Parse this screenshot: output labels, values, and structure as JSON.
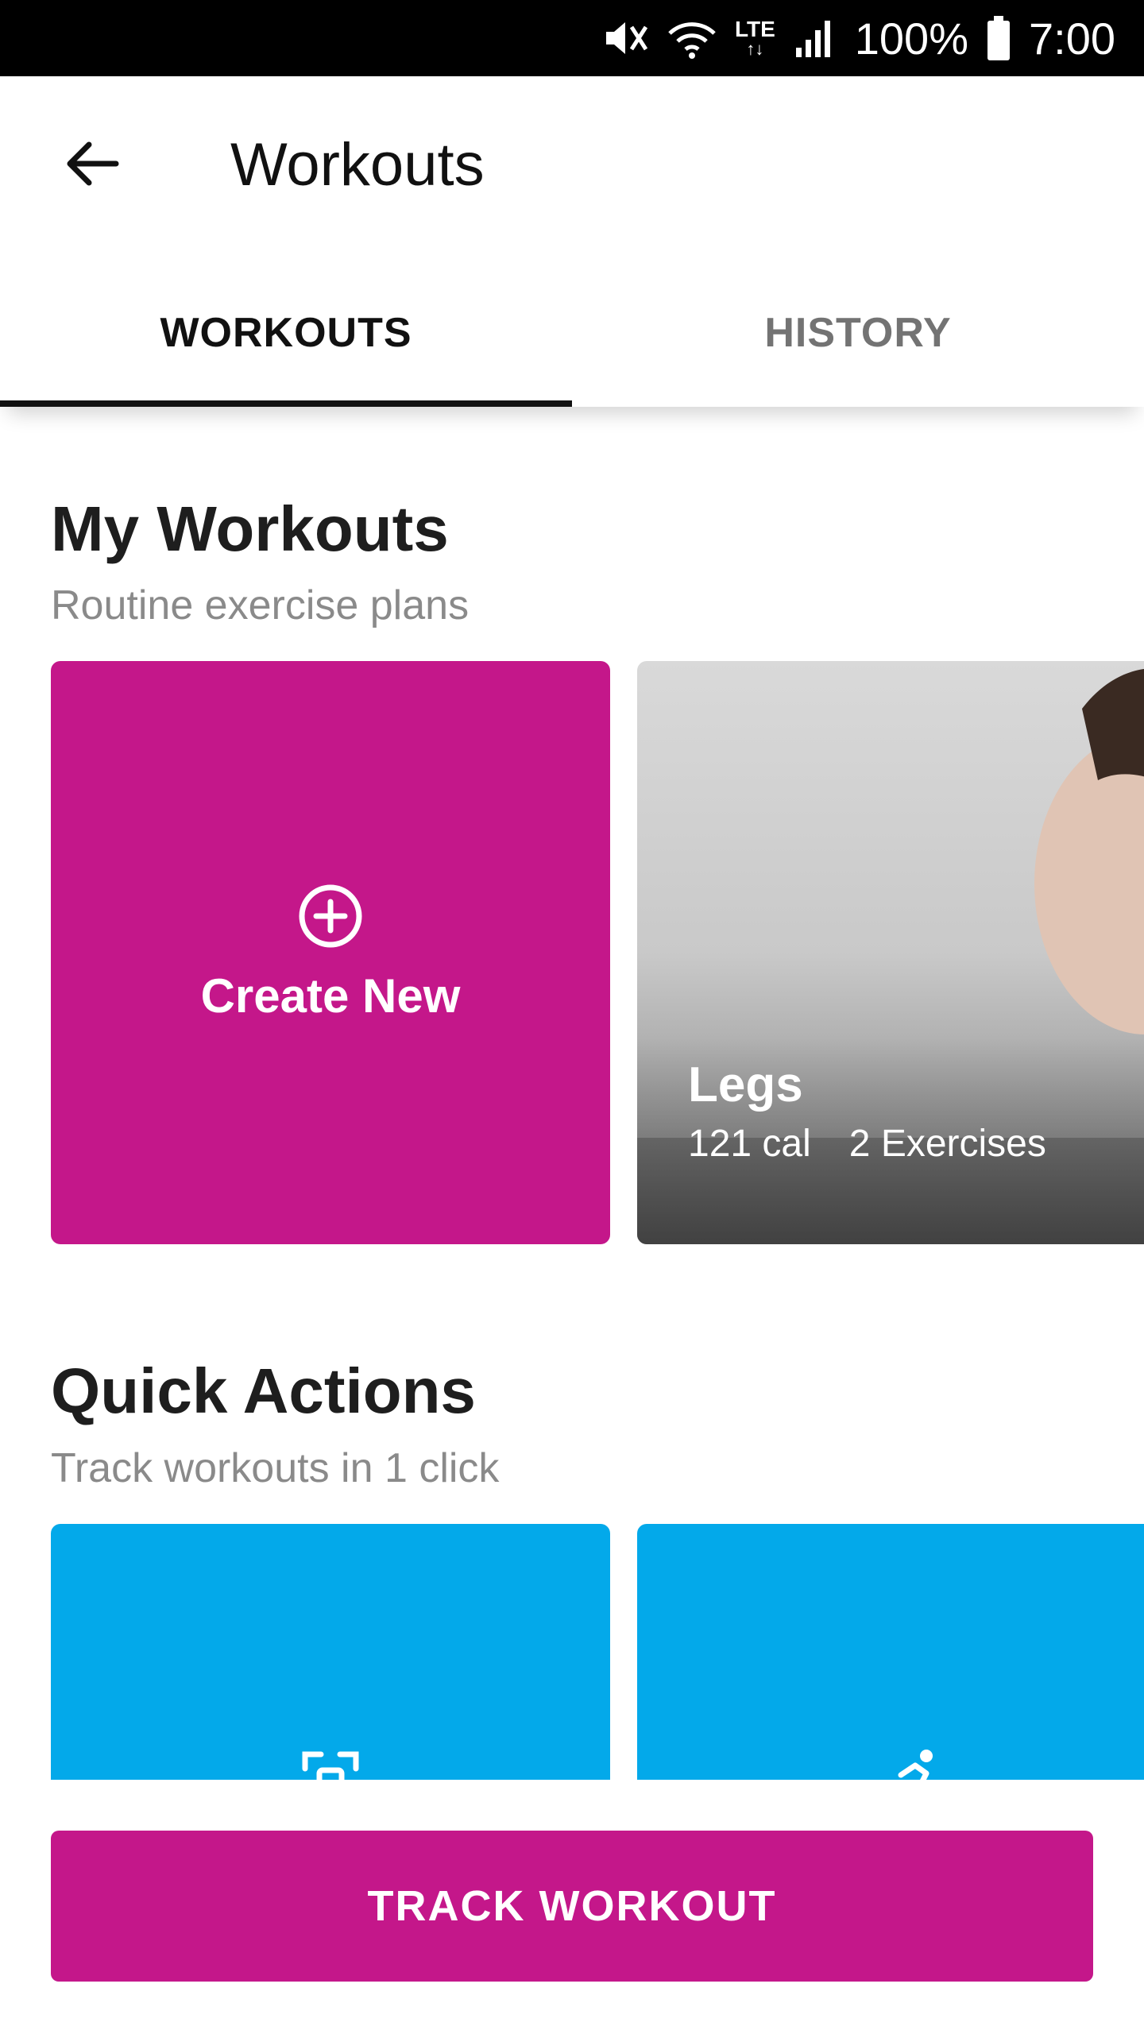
{
  "status_bar": {
    "battery": "100%",
    "time": "7:00",
    "network_label": "LTE",
    "icons": [
      "mute-icon",
      "wifi-icon",
      "lte-icon",
      "signal-icon",
      "battery-icon"
    ]
  },
  "app_bar": {
    "title": "Workouts",
    "back_icon": "arrow-left-icon"
  },
  "tabs": [
    {
      "label": "WORKOUTS",
      "active": true
    },
    {
      "label": "HISTORY",
      "active": false
    }
  ],
  "my_workouts": {
    "title": "My Workouts",
    "subtitle": "Routine exercise plans",
    "create_card": {
      "label": "Create New",
      "icon": "plus-circle-icon",
      "color": "#C4178A"
    },
    "workout_card": {
      "title": "Legs",
      "calories": "121 cal",
      "exercises": "2 Exercises"
    }
  },
  "quick_actions": {
    "title": "Quick Actions",
    "subtitle": "Track workouts in 1 click",
    "cards": [
      {
        "icon": "scan-icon"
      },
      {
        "icon": "running-person-icon"
      }
    ],
    "color": "#03A9EA"
  },
  "footer": {
    "button_label": "TRACK WORKOUT"
  }
}
